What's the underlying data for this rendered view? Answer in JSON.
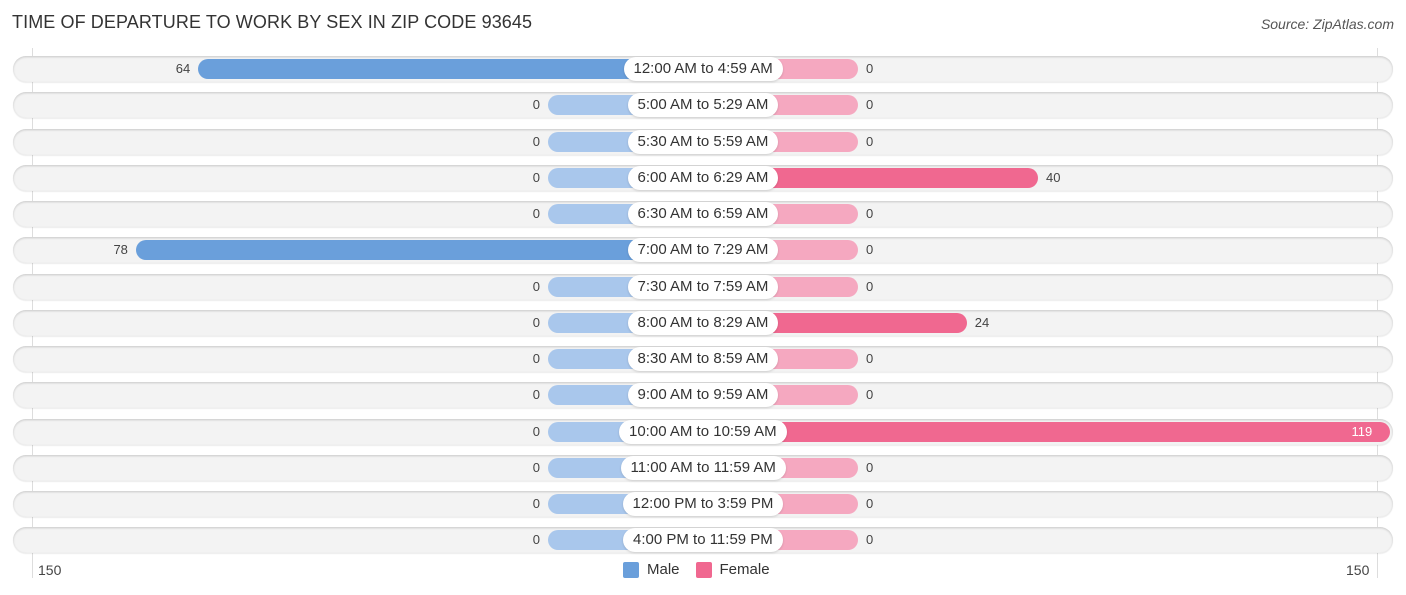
{
  "chart_data": {
    "type": "bar",
    "orientation": "horizontal-diverging",
    "title": "TIME OF DEPARTURE TO WORK BY SEX IN ZIP CODE 93645",
    "source": "Source: ZipAtlas.com",
    "categories": [
      "12:00 AM to 4:59 AM",
      "5:00 AM to 5:29 AM",
      "5:30 AM to 5:59 AM",
      "6:00 AM to 6:29 AM",
      "6:30 AM to 6:59 AM",
      "7:00 AM to 7:29 AM",
      "7:30 AM to 7:59 AM",
      "8:00 AM to 8:29 AM",
      "8:30 AM to 8:59 AM",
      "9:00 AM to 9:59 AM",
      "10:00 AM to 10:59 AM",
      "11:00 AM to 11:59 AM",
      "12:00 PM to 3:59 PM",
      "4:00 PM to 11:59 PM"
    ],
    "series": [
      {
        "name": "Male",
        "color": "#6a9fdb",
        "light_color": "#a9c7ec",
        "values": [
          64,
          0,
          0,
          0,
          0,
          78,
          0,
          0,
          0,
          0,
          0,
          0,
          0,
          0
        ]
      },
      {
        "name": "Female",
        "color": "#f06890",
        "light_color": "#f5a8c0",
        "values": [
          0,
          0,
          0,
          40,
          0,
          0,
          0,
          24,
          0,
          0,
          119,
          0,
          0,
          0
        ]
      }
    ],
    "axis": {
      "left_label": "150",
      "right_label": "150",
      "range": [
        -150,
        150
      ]
    },
    "legend": [
      "Male",
      "Female"
    ],
    "legend_position": "bottom-center"
  }
}
